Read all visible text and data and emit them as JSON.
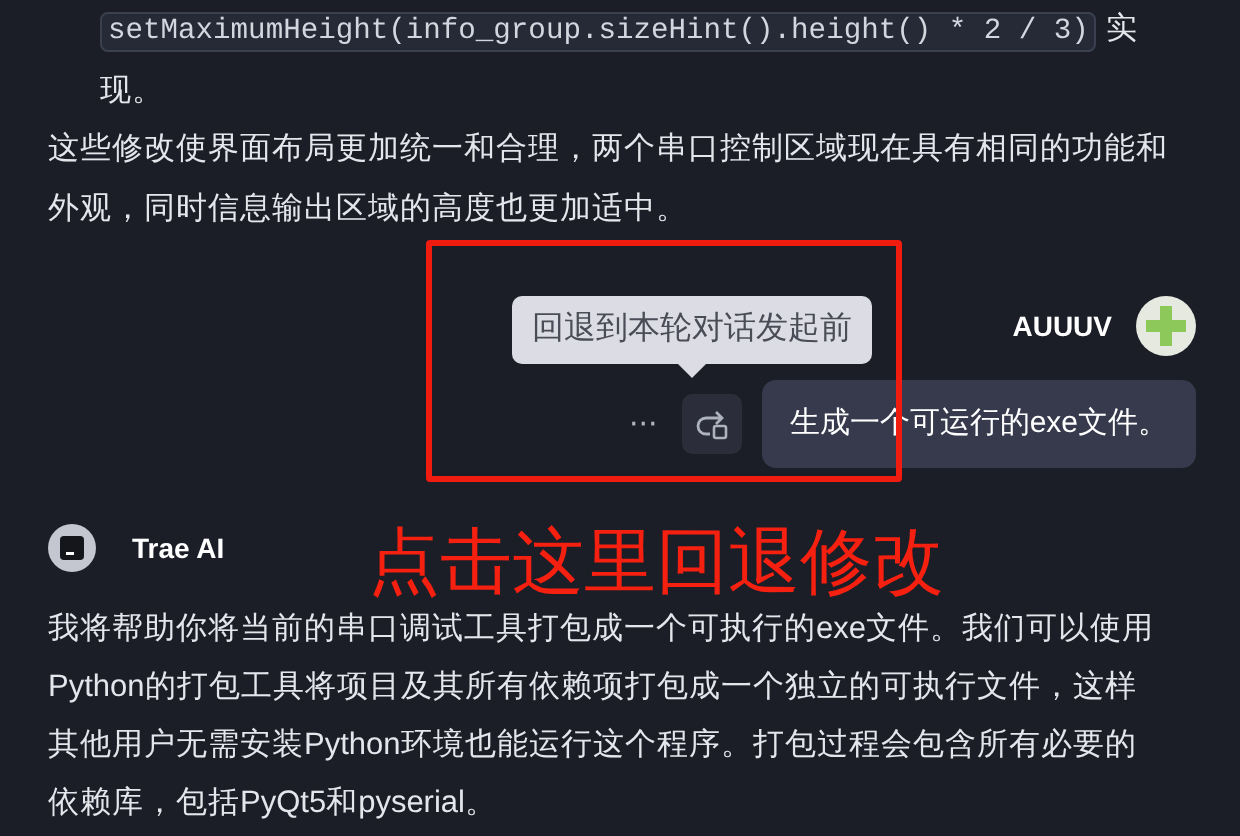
{
  "previous_item": {
    "code": "setMaximumHeight(info_group.sizeHint().height() * 2 / 3)",
    "text_after": "实现。"
  },
  "summary": "这些修改使界面布局更加统一和合理，两个串口控制区域现在具有相同的功能和外观，同时信息输出区域的高度也更加适中。",
  "user_message": {
    "author": "AUUUV",
    "more": "···",
    "tooltip": "回退到本轮对话发起前",
    "text": "生成一个可运行的exe文件。"
  },
  "assistant": {
    "author": "Trae AI",
    "text": "我将帮助你将当前的串口调试工具打包成一个可执行的exe文件。我们可以使用Python的打包工具将项目及其所有依赖项打包成一个独立的可执行文件，这样其他用户无需安装Python环境也能运行这个程序。打包过程会包含所有必要的依赖库，包括PyQt5和pyserial。"
  },
  "annotation": {
    "text": "点击这里回退修改"
  }
}
